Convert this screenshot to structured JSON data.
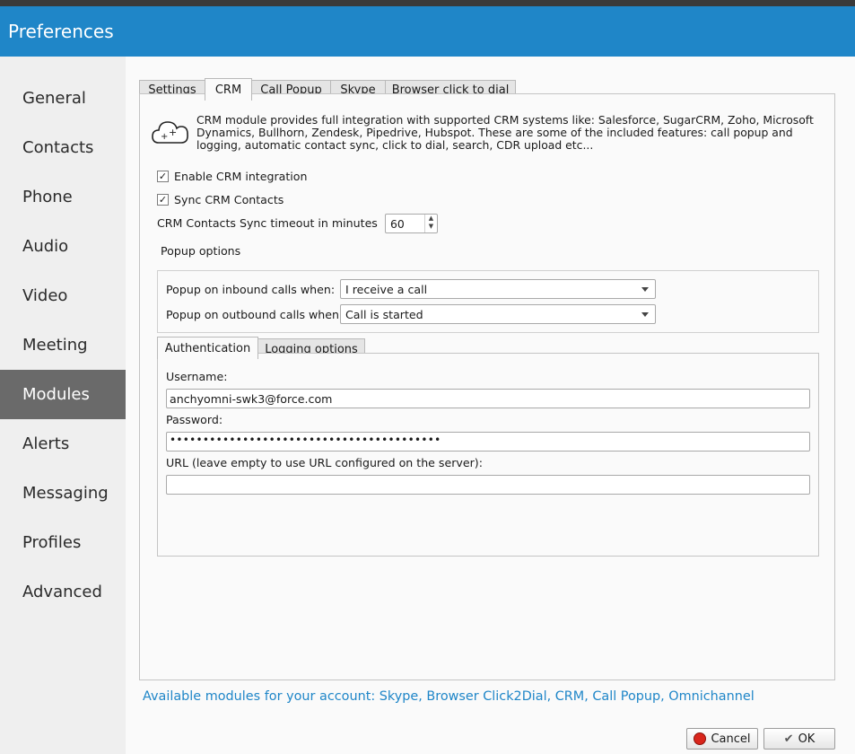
{
  "window": {
    "title": "Preferences"
  },
  "sidebar": {
    "items": [
      {
        "label": "General"
      },
      {
        "label": "Contacts"
      },
      {
        "label": "Phone"
      },
      {
        "label": "Audio"
      },
      {
        "label": "Video"
      },
      {
        "label": "Meeting"
      },
      {
        "label": "Modules",
        "active": true
      },
      {
        "label": "Alerts"
      },
      {
        "label": "Messaging"
      },
      {
        "label": "Profiles"
      },
      {
        "label": "Advanced"
      }
    ]
  },
  "tabs": [
    {
      "label": "Settings"
    },
    {
      "label": "CRM",
      "active": true
    },
    {
      "label": "Call Popup"
    },
    {
      "label": "Skype"
    },
    {
      "label": "Browser click to dial"
    }
  ],
  "crm": {
    "icon": "cloud-plus-icon",
    "description": "CRM module provides full integration with supported CRM systems like: Salesforce, SugarCRM, Zoho, Microsoft Dynamics, Bullhorn, Zendesk, Pipedrive, Hubspot. These are some of the included features: call popup and logging, automatic contact sync, click to dial, search, CDR upload etc...",
    "enable_label": "Enable CRM integration",
    "enable_checked": true,
    "sync_label": "Sync CRM Contacts",
    "sync_checked": true,
    "timeout_label": "CRM Contacts Sync timeout in minutes",
    "timeout_value": "60",
    "popup_title": "Popup options",
    "inbound_label": "Popup on inbound calls when:",
    "inbound_value": "I receive a call",
    "outbound_label": "Popup on outbound calls when:",
    "outbound_value": "Call is started"
  },
  "subtabs": [
    {
      "label": "Authentication",
      "active": true
    },
    {
      "label": "Logging options"
    }
  ],
  "auth": {
    "username_label": "Username:",
    "username_value": "anchyomni-swk3@force.com",
    "password_label": "Password:",
    "password_value": "•••••••••••••••••••••••••••••••••••••••••",
    "url_label": "URL (leave empty to use URL configured on the server):",
    "url_value": ""
  },
  "footer": {
    "modules_note": "Available modules for your account: Skype, Browser Click2Dial, CRM, Call Popup, Omnichannel",
    "cancel_label": "Cancel",
    "ok_label": "OK"
  },
  "colors": {
    "header": "#1f86c8",
    "active_nav": "#6a6a6a",
    "link": "#1f86c8"
  }
}
